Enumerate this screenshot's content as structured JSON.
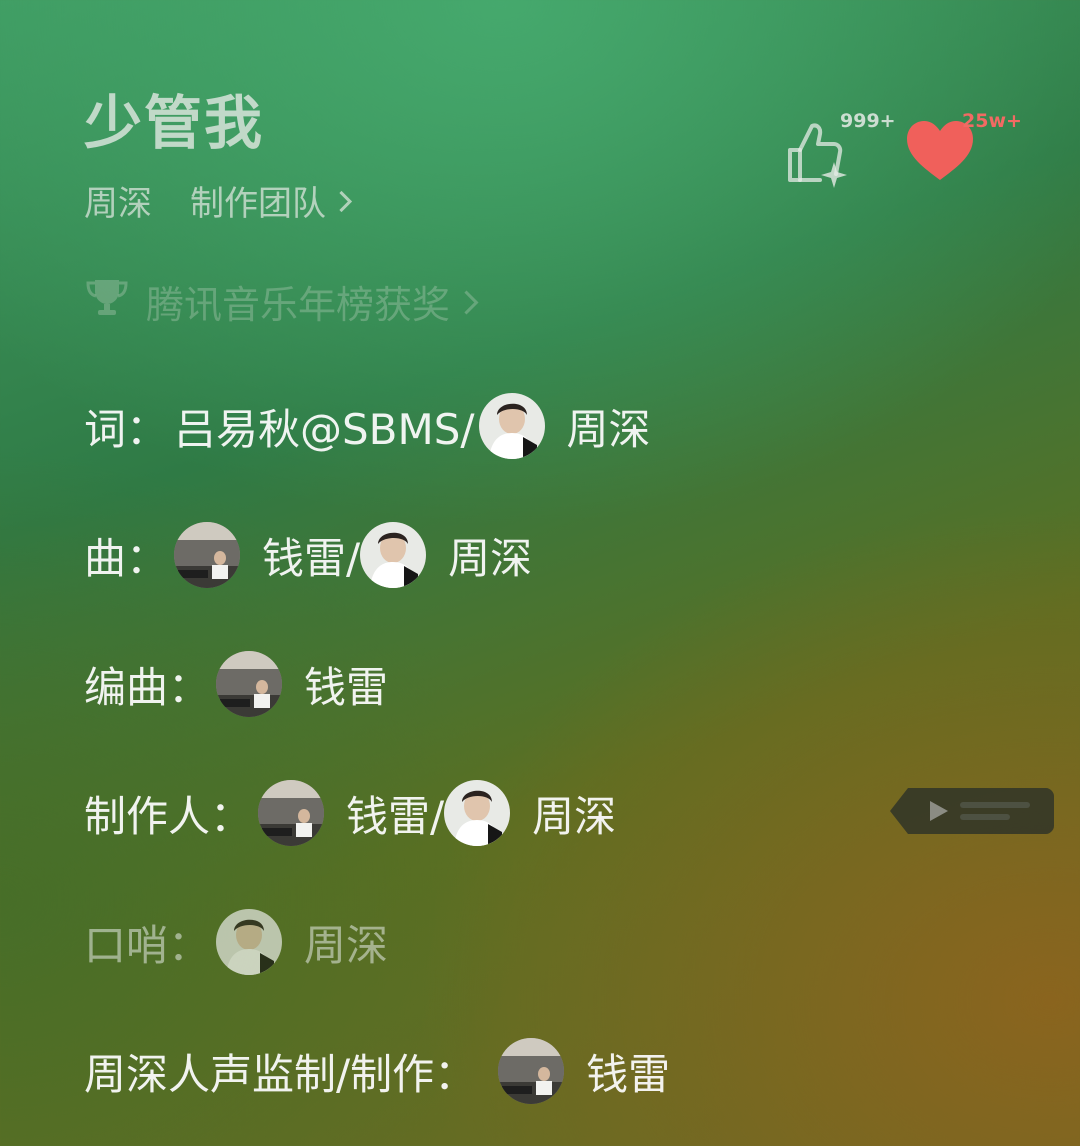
{
  "song": {
    "title": "少管我",
    "artist": "周深",
    "team_label": "制作团队"
  },
  "award": {
    "label": "腾讯音乐年榜获奖"
  },
  "actions": {
    "like_count": "999+",
    "fav_count": "25w+",
    "fav_color": "#f0605b"
  },
  "credits": {
    "lyrics": {
      "role": "词：",
      "text_prefix": "吕易秋@SBMS/",
      "person": "周深"
    },
    "composer": {
      "role": "曲：",
      "person1": "钱雷/",
      "person2": "周深"
    },
    "arranger": {
      "role": "编曲：",
      "person": "钱雷"
    },
    "producer": {
      "role": "制作人：",
      "person1": "钱雷/",
      "person2": "周深"
    },
    "whistle": {
      "role": "口哨：",
      "person": "周深"
    },
    "vocal_producer": {
      "role": "周深人声监制/制作：",
      "person": "钱雷"
    }
  }
}
